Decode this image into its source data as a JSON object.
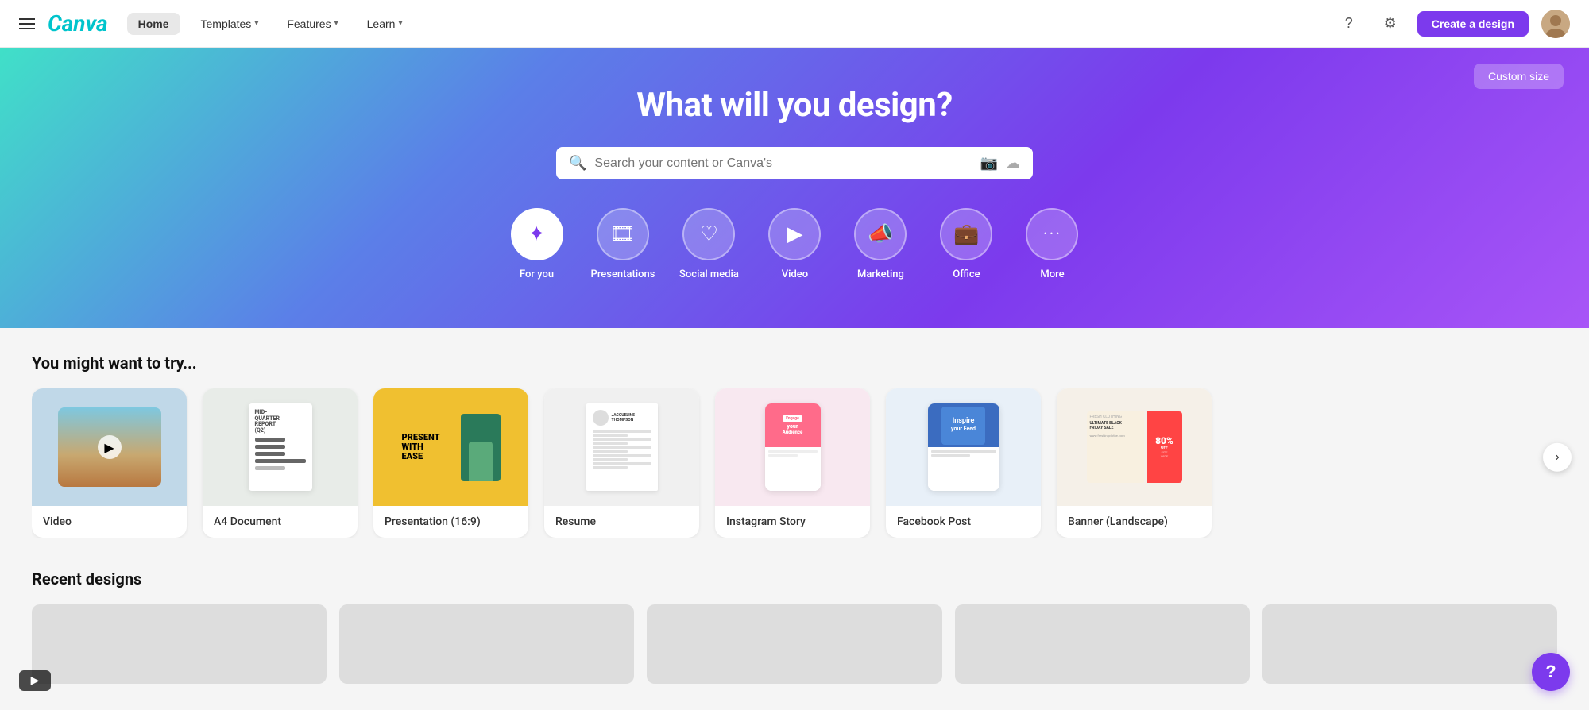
{
  "navbar": {
    "logo": "Canva",
    "home_label": "Home",
    "templates_label": "Templates",
    "features_label": "Features",
    "learn_label": "Learn",
    "create_label": "Create a design",
    "help_tooltip": "Help",
    "settings_tooltip": "Settings"
  },
  "hero": {
    "title": "What will you design?",
    "search_placeholder": "Search your content or Canva's",
    "custom_size_label": "Custom size"
  },
  "categories": [
    {
      "id": "for-you",
      "label": "For you",
      "icon": "✦",
      "active": true
    },
    {
      "id": "presentations",
      "label": "Presentations",
      "icon": "🎞"
    },
    {
      "id": "social-media",
      "label": "Social media",
      "icon": "♡"
    },
    {
      "id": "video",
      "label": "Video",
      "icon": "▶"
    },
    {
      "id": "marketing",
      "label": "Marketing",
      "icon": "📣"
    },
    {
      "id": "office",
      "label": "Office",
      "icon": "💼"
    },
    {
      "id": "more",
      "label": "More",
      "icon": "···"
    }
  ],
  "suggestions": {
    "title": "You might want to try...",
    "items": [
      {
        "id": "video",
        "label": "Video",
        "type": "video"
      },
      {
        "id": "a4-document",
        "label": "A4 Document",
        "type": "a4"
      },
      {
        "id": "presentation-16-9",
        "label": "Presentation (16:9)",
        "type": "pres"
      },
      {
        "id": "resume",
        "label": "Resume",
        "type": "resume"
      },
      {
        "id": "instagram-story",
        "label": "Instagram Story",
        "type": "insta"
      },
      {
        "id": "facebook-post",
        "label": "Facebook Post",
        "type": "fb"
      },
      {
        "id": "banner-landscape",
        "label": "Banner (Landscape)",
        "type": "banner"
      }
    ]
  },
  "recent": {
    "title": "Recent designs"
  },
  "help_label": "?",
  "video_bar_label": "▶"
}
